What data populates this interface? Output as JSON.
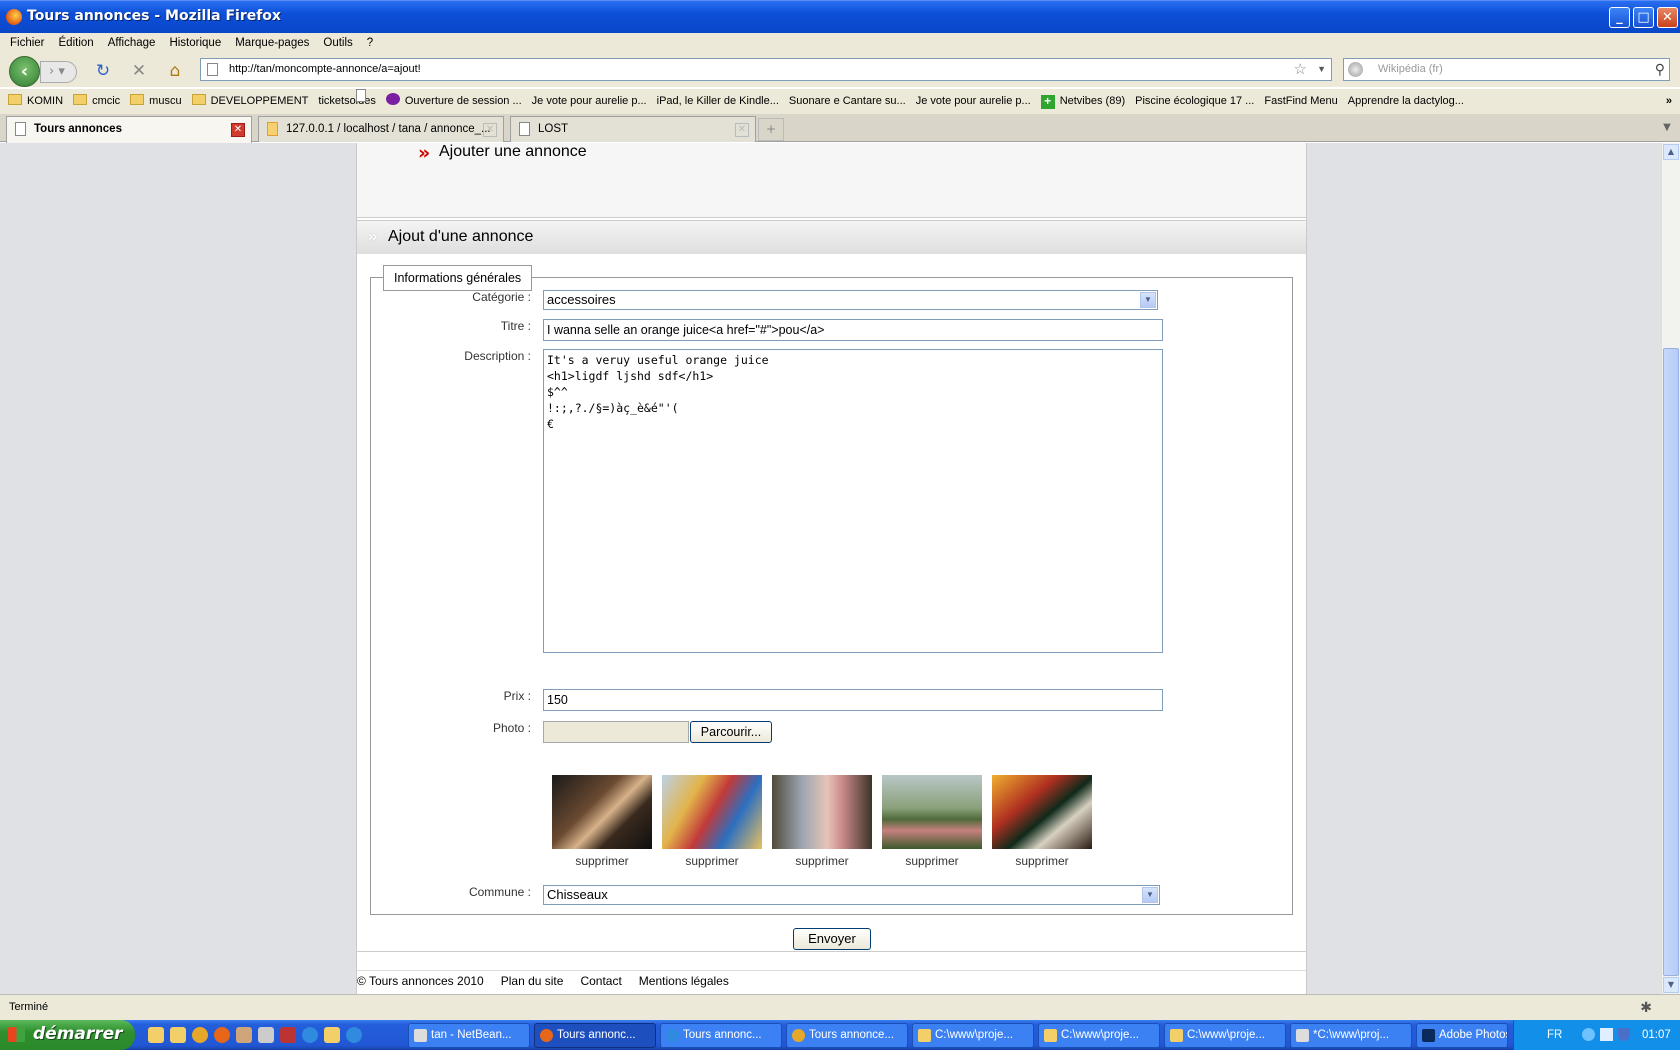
{
  "window": {
    "title": "Tours annonces - Mozilla Firefox"
  },
  "menu": [
    "Fichier",
    "Édition",
    "Affichage",
    "Historique",
    "Marque-pages",
    "Outils",
    "?"
  ],
  "address": {
    "url": "http://tan/moncompte-annonce/a=ajout!"
  },
  "search": {
    "placeholder": "Wikipédia (fr)"
  },
  "bookmarks": [
    {
      "label": "KOMIN",
      "icon": "folder-icon"
    },
    {
      "label": "cmcic",
      "icon": "folder-icon"
    },
    {
      "label": "muscu",
      "icon": "folder-icon"
    },
    {
      "label": "DEVELOPPEMENT",
      "icon": "folder-icon"
    },
    {
      "label": "ticketsoldes",
      "icon": "page-icon"
    },
    {
      "label": "Ouverture de session ...",
      "icon": "yahoo-icon"
    },
    {
      "label": "Je vote pour aurelie p...",
      "icon": "page-icon"
    },
    {
      "label": "iPad, le Killer de Kindle...",
      "icon": "page-icon"
    },
    {
      "label": "Suonare e Cantare su...",
      "icon": "page-icon"
    },
    {
      "label": "Je vote pour aurelie p...",
      "icon": "page-icon"
    },
    {
      "label": "Netvibes (89)",
      "icon": "netvibes-icon"
    },
    {
      "label": "Piscine écologique 17 ...",
      "icon": "page-icon"
    },
    {
      "label": "FastFind Menu",
      "icon": "page-icon"
    },
    {
      "label": "Apprendre la dactylog...",
      "icon": "page-icon"
    }
  ],
  "tabs": [
    {
      "label": "Tours annonces"
    },
    {
      "label": "127.0.0.1 / localhost / tana / annonce_..."
    },
    {
      "label": "LOST"
    }
  ],
  "page": {
    "top_link": "Ajouter une annonce",
    "section_title": "Ajout d'une annonce",
    "legend": "Informations générales",
    "category": {
      "label": "Catégorie :",
      "value": "accessoires"
    },
    "title_field": {
      "label": "Titre :",
      "value": "I wanna selle an orange juice<a href=\"#\">pou</a>"
    },
    "description": {
      "label": "Description :",
      "value": "It's a veruy useful orange juice\n<h1>ligdf ljshd sdf</h1>\n$^^\n!:;,?./§=)àç_è&é\"'(\n€"
    },
    "price": {
      "label": "Prix :",
      "value": "150"
    },
    "photo": {
      "label": "Photo :",
      "browse": "Parcourir..."
    },
    "photos": [
      {
        "action": "supprimer"
      },
      {
        "action": "supprimer"
      },
      {
        "action": "supprimer"
      },
      {
        "action": "supprimer"
      },
      {
        "action": "supprimer"
      }
    ],
    "commune": {
      "label": "Commune :",
      "value": "Chisseaux"
    },
    "submit": "Envoyer",
    "footer": [
      "© Tours annonces 2010",
      "Plan du site",
      "Contact",
      "Mentions légales"
    ]
  },
  "status": "Terminé",
  "taskbar": {
    "start": "démarrer",
    "tasks": [
      "tan - NetBean...",
      "Tours annonc...",
      "Tours annonc...",
      "Tours annonce...",
      "C:\\www\\proje...",
      "C:\\www\\proje...",
      "C:\\www\\proje...",
      "*C:\\www\\proj...",
      "Adobe Photos..."
    ],
    "lang": "FR",
    "clock": "01:07"
  }
}
